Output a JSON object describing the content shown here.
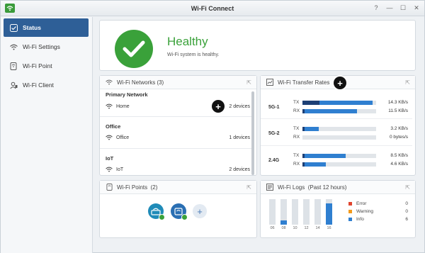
{
  "window": {
    "title": "Wi-Fi Connect",
    "controls": [
      "?",
      "—",
      "☐",
      "✕"
    ]
  },
  "sidebar": {
    "items": [
      {
        "label": "Status",
        "icon": "status-icon",
        "active": true
      },
      {
        "label": "Wi-Fi Settings",
        "icon": "wifi-icon",
        "active": false
      },
      {
        "label": "Wi-Fi Point",
        "icon": "router-icon",
        "active": false
      },
      {
        "label": "Wi-Fi Client",
        "icon": "client-icon",
        "active": false
      }
    ]
  },
  "health": {
    "title": "Healthy",
    "description": "Wi-Fi system is healthy.",
    "color": "#3aa13a"
  },
  "networks": {
    "title": "Wi-Fi Networks (3)",
    "groups": [
      {
        "name": "Primary Network",
        "ssid": "Home",
        "devices": "2 devices"
      },
      {
        "name": "Office",
        "ssid": "Office",
        "devices": "1 devices"
      },
      {
        "name": "IoT",
        "ssid": "IoT",
        "devices": "2 devices"
      }
    ]
  },
  "transfer": {
    "title": "Wi-Fi Transfer Rates",
    "bands": [
      {
        "name": "5G-1",
        "tx_label": "TX",
        "tx_value": "14.3 KB/s",
        "tx_level": 0.95,
        "rx_label": "RX",
        "rx_value": "11.5 KB/s",
        "rx_level": 0.74
      },
      {
        "name": "5G-2",
        "tx_label": "TX",
        "tx_value": "3.2 KB/s",
        "tx_level": 0.22,
        "rx_label": "RX",
        "rx_value": "0 bytes/s",
        "rx_level": 0.0
      },
      {
        "name": "2.4G",
        "tx_label": "TX",
        "tx_value": "8.5 KB/s",
        "tx_level": 0.59,
        "rx_label": "RX",
        "rx_value": "4.6 KB/s",
        "rx_level": 0.32
      }
    ]
  },
  "points": {
    "title": "Wi-Fi Points",
    "count": "(2)"
  },
  "logs": {
    "title": "Wi-Fi Logs",
    "subtitle": "(Past 12 hours)",
    "chart_data": {
      "type": "bar",
      "categories": [
        "06",
        "08",
        "10",
        "12",
        "14",
        "16"
      ],
      "values": [
        0,
        1,
        0,
        0,
        0,
        5
      ],
      "ylim": [
        0,
        6
      ]
    },
    "legend": [
      {
        "label": "Error",
        "count": "0",
        "color": "#e0452f"
      },
      {
        "label": "Warning",
        "count": "0",
        "color": "#f39a1b"
      },
      {
        "label": "Info",
        "count": "6",
        "color": "#2f7fd0"
      }
    ]
  }
}
